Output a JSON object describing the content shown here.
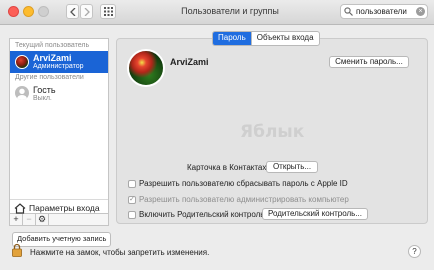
{
  "window": {
    "title": "Пользователи и группы"
  },
  "search": {
    "value": "пользователи"
  },
  "sidebar": {
    "current_section": "Текущий пользователь",
    "current_user": {
      "name": "ArviZami",
      "role": "Администратор"
    },
    "other_section": "Другие пользователи",
    "guest": {
      "name": "Гость",
      "status": "Выкл."
    },
    "login_options": "Параметры входа",
    "tools": [
      "+",
      "−",
      "⚙"
    ]
  },
  "add_account_label": "Добавить учетную запись",
  "tabs": [
    {
      "label": "Пароль",
      "active": true
    },
    {
      "label": "Объекты входа",
      "active": false
    }
  ],
  "profile": {
    "name": "ArviZami",
    "change_password": "Сменить пароль..."
  },
  "watermark": "Яблык",
  "contacts": {
    "label": "Карточка в Контактах:",
    "button": "Открыть..."
  },
  "options": {
    "reset_apple_id": {
      "label": "Разрешить пользователю сбрасывать пароль с Apple ID",
      "checked": false
    },
    "allow_admin": {
      "label": "Разрешить пользователю администрировать компьютер",
      "checked": true
    },
    "parental": {
      "label": "Включить Родительский контроль",
      "checked": false,
      "button": "Родительский контроль..."
    }
  },
  "lock_text": "Нажмите на замок, чтобы запретить изменения.",
  "help": "?"
}
